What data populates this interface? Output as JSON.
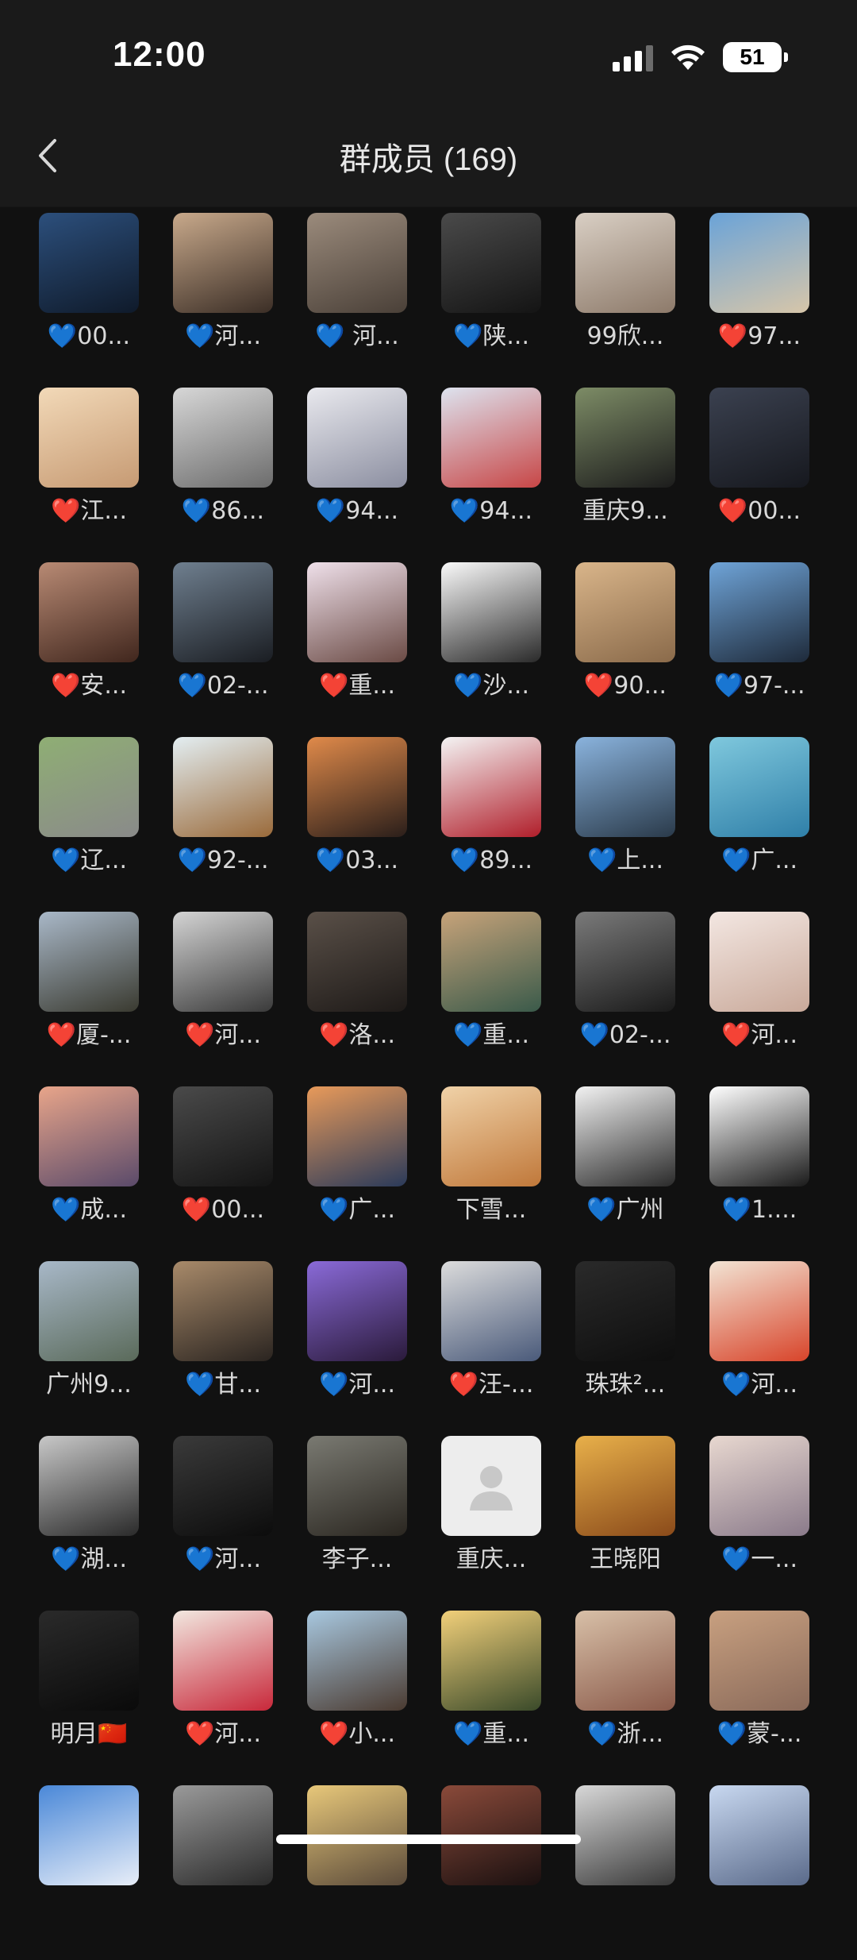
{
  "status_bar": {
    "time": "12:00",
    "battery": "51"
  },
  "header": {
    "title": "群成员 (169)"
  },
  "members": [
    {
      "name": "💙00...",
      "colors": [
        "#2c4f7c",
        "#0f1a2a"
      ]
    },
    {
      "name": "💙河...",
      "colors": [
        "#c8a98b",
        "#3b2e26"
      ]
    },
    {
      "name": "💙  河...",
      "colors": [
        "#9b8b7c",
        "#4a4038"
      ]
    },
    {
      "name": "💙陕...",
      "colors": [
        "#4a4a4a",
        "#141414"
      ]
    },
    {
      "name": "99欣...",
      "colors": [
        "#d9cfc4",
        "#8d7a6a"
      ]
    },
    {
      "name": "❤️97...",
      "colors": [
        "#6aa3d8",
        "#d7c6a9"
      ]
    },
    {
      "name": "❤️江...",
      "colors": [
        "#f2d9b8",
        "#c69a73"
      ]
    },
    {
      "name": "💙86...",
      "colors": [
        "#d7d7d7",
        "#6c6c6c"
      ]
    },
    {
      "name": "💙94...",
      "colors": [
        "#e9e9ee",
        "#8b8ea0"
      ]
    },
    {
      "name": "💙94...",
      "colors": [
        "#dde3ef",
        "#c74646"
      ]
    },
    {
      "name": "重庆9...",
      "colors": [
        "#7d8c66",
        "#1c1c1c"
      ]
    },
    {
      "name": "❤️00...",
      "colors": [
        "#3b4150",
        "#16181e"
      ]
    },
    {
      "name": "❤️安...",
      "colors": [
        "#b88a74",
        "#40261d"
      ]
    },
    {
      "name": "💙02-...",
      "colors": [
        "#6f7f8f",
        "#1a1d22"
      ]
    },
    {
      "name": "❤️重...",
      "colors": [
        "#efe0ea",
        "#6a4a44"
      ]
    },
    {
      "name": "💙沙...",
      "colors": [
        "#fafafa",
        "#2a2a2a"
      ]
    },
    {
      "name": "❤️90...",
      "colors": [
        "#d9b58a",
        "#8a6a4a"
      ]
    },
    {
      "name": "💙97-...",
      "colors": [
        "#6fa4d8",
        "#1e2a3a"
      ]
    },
    {
      "name": "💙辽...",
      "colors": [
        "#8fae74",
        "#8a8a8a"
      ]
    },
    {
      "name": "💙92-...",
      "colors": [
        "#e3eef2",
        "#9a6a3a"
      ]
    },
    {
      "name": "💙03...",
      "colors": [
        "#e08a4a",
        "#2a1e1a"
      ]
    },
    {
      "name": "💙89...",
      "colors": [
        "#f4f4f4",
        "#b01e2a"
      ]
    },
    {
      "name": "💙上...",
      "colors": [
        "#8ab3dd",
        "#2a3a4a"
      ]
    },
    {
      "name": "💙广...",
      "colors": [
        "#7fc8dd",
        "#2f7fa8"
      ]
    },
    {
      "name": "❤️厦-...",
      "colors": [
        "#a9b8c8",
        "#3a3a30"
      ]
    },
    {
      "name": "❤️河...",
      "colors": [
        "#d4d4d4",
        "#3a3a3a"
      ]
    },
    {
      "name": "❤️洛...",
      "colors": [
        "#5a5048",
        "#1e1a18"
      ]
    },
    {
      "name": "💙重...",
      "colors": [
        "#c7a37a",
        "#3a5a4a"
      ]
    },
    {
      "name": "💙02-...",
      "colors": [
        "#7a7a7a",
        "#1a1a1a"
      ]
    },
    {
      "name": "❤️河...",
      "colors": [
        "#f3e7e2",
        "#c9a99a"
      ]
    },
    {
      "name": "💙成...",
      "colors": [
        "#e8a58a",
        "#5a4a6a"
      ]
    },
    {
      "name": "❤️00...",
      "colors": [
        "#4a4a4a",
        "#141414"
      ]
    },
    {
      "name": "💙广...",
      "colors": [
        "#e89a5a",
        "#2a3a5a"
      ]
    },
    {
      "name": "下雪...",
      "colors": [
        "#f0d2a8",
        "#c0783a"
      ]
    },
    {
      "name": "💙广州",
      "colors": [
        "#f2f2f2",
        "#2a2a2a"
      ]
    },
    {
      "name": "💙1....",
      "colors": [
        "#ffffff",
        "#1a1a1a"
      ]
    },
    {
      "name": "广州9...",
      "colors": [
        "#a8b8c8",
        "#5a6a5a"
      ]
    },
    {
      "name": "💙甘...",
      "colors": [
        "#a88a6a",
        "#2a2420"
      ]
    },
    {
      "name": "💙河...",
      "colors": [
        "#8a6ad8",
        "#2a1a3a"
      ]
    },
    {
      "name": "❤️汪-...",
      "colors": [
        "#dcdcdc",
        "#4a5a7a"
      ]
    },
    {
      "name": "珠珠²...",
      "colors": [
        "#2a2a2a",
        "#0e0e0e"
      ]
    },
    {
      "name": "💙河...",
      "colors": [
        "#f2e4d4",
        "#d8442a"
      ]
    },
    {
      "name": "💙湖...",
      "colors": [
        "#c8c8c8",
        "#2a2a2a"
      ]
    },
    {
      "name": "💙河...",
      "colors": [
        "#3a3a3a",
        "#0c0c0c"
      ]
    },
    {
      "name": "李子...",
      "colors": [
        "#7a7a72",
        "#2a2620"
      ]
    },
    {
      "name": "重庆...",
      "colors": [
        "#ededed",
        "#ededed"
      ],
      "default": true
    },
    {
      "name": "王晓阳",
      "colors": [
        "#e8b04a",
        "#8a4a1a"
      ]
    },
    {
      "name": "💙一...",
      "colors": [
        "#e8d8d0",
        "#8a7a8a"
      ]
    },
    {
      "name": "明月🇨🇳",
      "colors": [
        "#2a2a2a",
        "#0a0a0a"
      ]
    },
    {
      "name": "❤️河...",
      "colors": [
        "#f2e8e0",
        "#c8283a"
      ]
    },
    {
      "name": "❤️小...",
      "colors": [
        "#a8c8e0",
        "#4a3a30"
      ]
    },
    {
      "name": "💙重...",
      "colors": [
        "#f2d07a",
        "#3a4a2a"
      ]
    },
    {
      "name": "💙浙...",
      "colors": [
        "#d8c0a8",
        "#8a5a4a"
      ]
    },
    {
      "name": "💙蒙-...",
      "colors": [
        "#c8a080",
        "#8a6a5a"
      ]
    },
    {
      "name": "",
      "colors": [
        "#4a88d8",
        "#e8eef8"
      ]
    },
    {
      "name": "",
      "colors": [
        "#9a9a9a",
        "#2a2a2a"
      ]
    },
    {
      "name": "",
      "colors": [
        "#e8c87a",
        "#5a4a3a"
      ]
    },
    {
      "name": "",
      "colors": [
        "#8a4a3a",
        "#1a1010"
      ]
    },
    {
      "name": "",
      "colors": [
        "#d8d8d8",
        "#3a3a3a"
      ]
    },
    {
      "name": "",
      "colors": [
        "#c8d8f0",
        "#5a6a8a"
      ]
    }
  ]
}
